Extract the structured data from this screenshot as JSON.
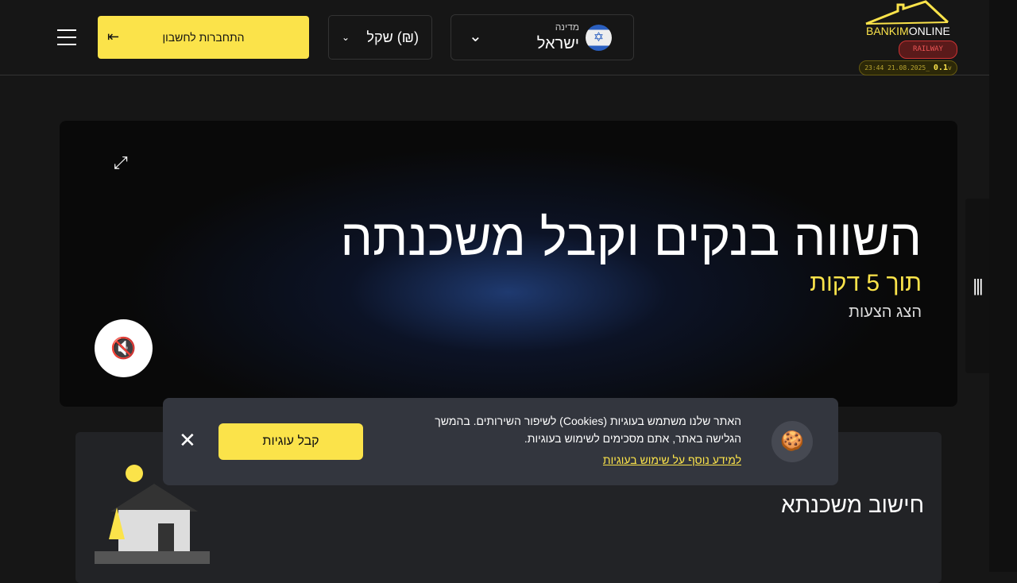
{
  "header": {
    "logo": {
      "part1": "BANKIM",
      "part2": "ONLINE"
    },
    "env_badge": "RAILWAY",
    "version": {
      "timestamp": "23:44 21.08.2025_",
      "number": "0.1",
      "suffix": "v"
    },
    "country": {
      "label": "מדינה",
      "value": "ישראל"
    },
    "currency": {
      "value": "(₪) שקל"
    },
    "login_label": "התחברות לחשבון"
  },
  "hero": {
    "title": "השווה בנקים וקבל משכנתה",
    "subtitle": "תוך 5 דקות",
    "cta": "הצג הצעות"
  },
  "card": {
    "title": "חישוב משכנתא"
  },
  "cookie": {
    "message": "האתר שלנו משתמש בעוגיות (Cookies) לשיפור השירותים. בהמשך הגלישה באתר, אתם מסכימים לשימוש בעוגיות.",
    "link": "למידע נוסף על שימוש בעוגיות",
    "accept": "קבל עוגיות"
  }
}
